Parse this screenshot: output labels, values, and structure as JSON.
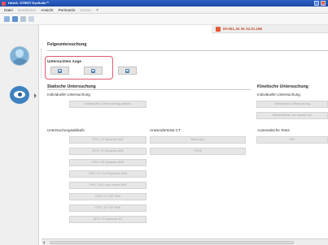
{
  "window": {
    "title": "HAAG- STREIT EyeSuite™"
  },
  "menu": [
    "Datei",
    "Bearbeiten",
    "Ansicht",
    "Perimetrie",
    "Extras",
    "?"
  ],
  "menu_disabled": [
    false,
    true,
    false,
    false,
    true,
    false
  ],
  "patient": {
    "label": "00-001, M. M. 01.01.198"
  },
  "main": {
    "title": "Folgeuntersuchung",
    "eye_section": "Untersuchtes Auge",
    "static": {
      "title": "Statische Untersuchung",
      "individual_label": "Individuelle Untersuchung",
      "individual_button": "Individuelle Untersuchung starten"
    },
    "kinetic": {
      "title": "Kinetische Untersuchung",
      "individual_label": "Individuelle Untersuchung",
      "individual_button": "Individuelle Untersuchung",
      "resume_button": "Wiederführen der letzten Unt"
    },
    "sequences": {
      "label": "Untersuchungsabläufe",
      "items": [
        "OPS / G Dynamic WW",
        "OPS / G Dynamic WW",
        "OPS / 32 Dynamic WW",
        "OPS / 07 DLT/Dynamic WW",
        "OPS / LVC Low Vision WW",
        "OPS / G TOP WW",
        "OPS / M TOP WW",
        "OPS / G Dynamic BY"
      ]
    },
    "tests": {
      "label": "Anwendertests CT",
      "items": [
        "Blind spot",
        "TOKE"
      ]
    },
    "auto": {
      "label": "Automatische Tests",
      "items": [
        "Wet"
      ]
    }
  }
}
